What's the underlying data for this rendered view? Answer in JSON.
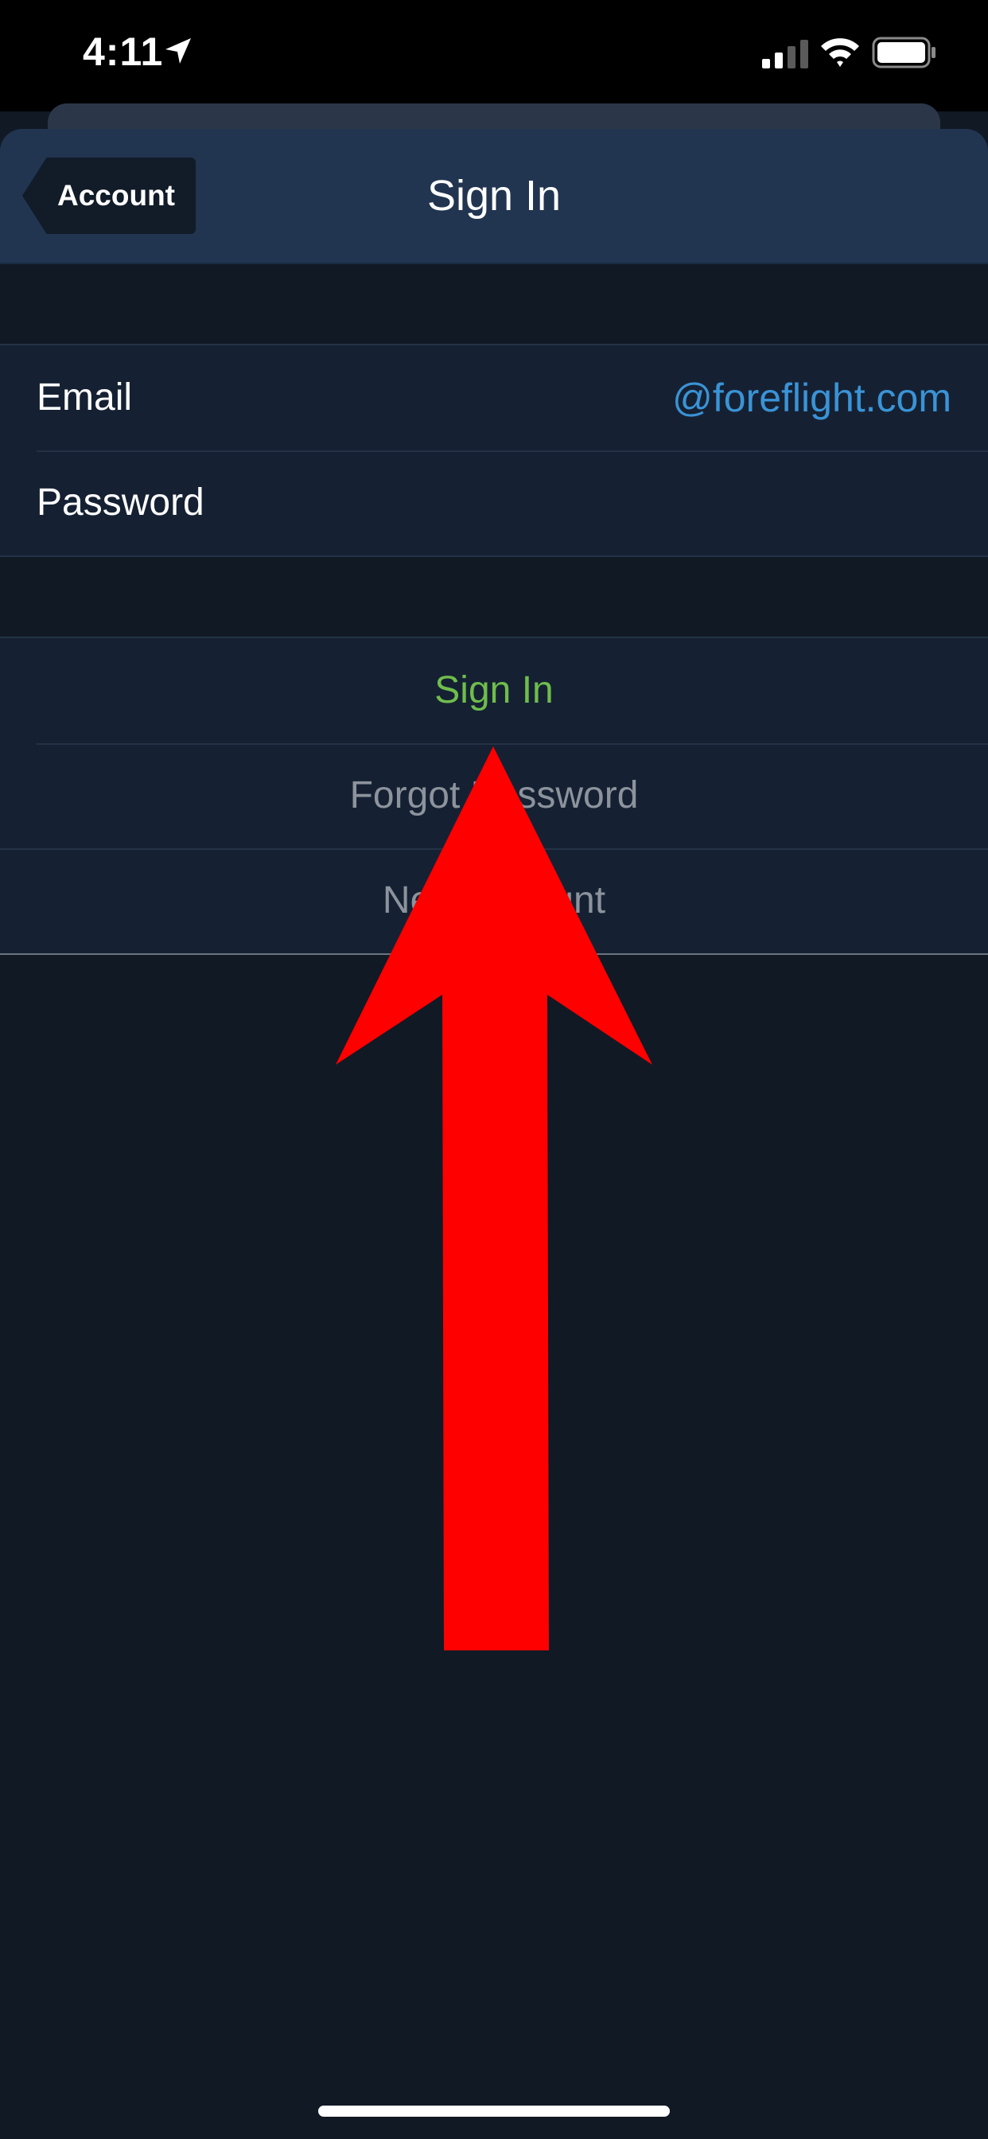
{
  "status_bar": {
    "time": "4:11",
    "location_icon": "location-arrow-icon",
    "signal_icon": "cellular-signal-icon",
    "wifi_icon": "wifi-icon",
    "battery_icon": "battery-icon"
  },
  "nav": {
    "back_label": "Account",
    "title": "Sign In"
  },
  "form": {
    "email_label": "Email",
    "email_value": "@foreflight.com",
    "password_label": "Password"
  },
  "actions": {
    "sign_in": "Sign In",
    "forgot_password": "Forgot Password",
    "new_account": "New Account"
  },
  "colors": {
    "background": "#111925",
    "nav_bar": "#213550",
    "group": "#152133",
    "link_blue": "#3a93d6",
    "sign_in_green": "#6fbd4c",
    "muted_gray": "#8c939c",
    "annotation_red": "#ff0000"
  },
  "annotation": {
    "icon": "red-up-arrow-icon"
  }
}
